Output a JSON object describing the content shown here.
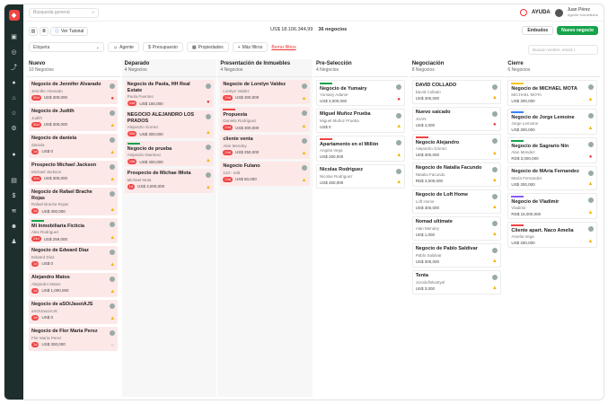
{
  "topbar": {
    "search_placeholder": "Búsqueda general",
    "ayuda": "AYUDA",
    "user_name": "Juan Pérez",
    "user_role": "Agente Inmobiliario"
  },
  "toolbar": {
    "tutorial": "Ver Tutorial",
    "total_amount": "US$ 18.106.344,99",
    "total_deals": "36 negocios",
    "embudos": "Embudos",
    "nuevo": "Nuevo negocio"
  },
  "filters": {
    "etiqueta": "Etiqueta",
    "agente": "Agente",
    "presupuesto": "Presupuesto",
    "propiedades": "Propiedades",
    "mas": "Más filtros",
    "borrar": "Borrar filtros",
    "board_search": "Buscar nombre, email, t"
  },
  "colors": {
    "red_badge": "#ef4444",
    "green": "#16a34a",
    "sidebar": "#1d2e2c"
  },
  "columns": [
    {
      "title": "Nuevo",
      "count": "10 Negocios",
      "shaded": false,
      "cards": [
        {
          "title": "Negocio de Jennifer Alvarado",
          "contact": "Jennifer Alvarado",
          "badge": "30d",
          "amount": "US$ 300,000",
          "bar": "",
          "red": true,
          "status": "err"
        },
        {
          "title": "Negocio de Judith",
          "contact": "Judith",
          "badge": "30d",
          "amount": "US$ 300,000",
          "bar": "",
          "red": true,
          "status": "warn"
        },
        {
          "title": "Negocio de daniela",
          "contact": "daniela",
          "badge": "1d",
          "amount": "US$ 0",
          "bar": "",
          "red": true,
          "status": "warn"
        },
        {
          "title": "Prospecto Michael Jackson",
          "contact": "Michael Jackson",
          "badge": "10d",
          "amount": "US$ 300,000",
          "bar": "",
          "red": true,
          "status": "warn"
        },
        {
          "title": "Negocio de Rafael Brache Rojas",
          "contact": "Rafael Brache Rojas",
          "badge": "1d",
          "amount": "US$ 300,000",
          "bar": "",
          "red": true,
          "status": "warn"
        },
        {
          "title": "Mi Inmobiliaria Ficticia",
          "contact": "Alex Rodriguez",
          "badge": "24d",
          "amount": "US$ 259,000",
          "bar": "#16a34a",
          "red": true,
          "status": "warn"
        },
        {
          "title": "Negocio de Edward Diaz",
          "contact": "Edward Díaz",
          "badge": "1d",
          "amount": "US$ 0",
          "bar": "",
          "red": true,
          "status": "warn"
        },
        {
          "title": "Alejandro Matos",
          "contact": "Alejandro Matos",
          "badge": "1d",
          "amount": "US$ 1,000,000",
          "bar": "",
          "red": true,
          "status": "warn"
        },
        {
          "title": "Negocio de aSOiJasoiAJS",
          "contact": "aSOiJasoiAJS",
          "badge": "1d",
          "amount": "US$ 0",
          "bar": "",
          "red": true,
          "status": "warn"
        },
        {
          "title": "Negocio de Flor Maria Perez",
          "contact": "Flor María Perez",
          "badge": "1d",
          "amount": "US$ 300,000",
          "bar": "",
          "red": true,
          "status": "ok"
        }
      ]
    },
    {
      "title": "Deparado",
      "count": "4 Negocios",
      "shaded": true,
      "cards": [
        {
          "title": "Negocio de Paola, HH Real Estate",
          "contact": "Paola Fuentes",
          "badge": "24d",
          "amount": "US$ 150,000",
          "bar": "",
          "red": true,
          "status": "err"
        },
        {
          "title": "NEGOCIO ALEJANDRO LOS PRADOS",
          "contact": "Alejandro Gomez",
          "badge": "30d",
          "amount": "US$ 300,000",
          "bar": "",
          "red": true,
          "status": "warn"
        },
        {
          "title": "Negocio de prueba",
          "contact": "Alejandro Martinez",
          "badge": "24d",
          "amount": "US$ 300,000",
          "bar": "#16a34a",
          "red": true,
          "status": "warn"
        },
        {
          "title": "Prospecto de Michae lMota",
          "contact": "Michael Mota",
          "badge": "1d",
          "amount": "US$ 3,000,000",
          "bar": "",
          "red": true,
          "status": "warn"
        }
      ]
    },
    {
      "title": "Presentación de Inmuebles",
      "count": "4 Negocios",
      "shaded": true,
      "cards": [
        {
          "title": "Negocio de Lorelyn Valdez",
          "contact": "Lorelyn Valdez",
          "badge": "24d",
          "amount": "US$ 300,000",
          "bar": "",
          "red": true,
          "status": "warn"
        },
        {
          "title": "Propuesta",
          "contact": "Daniela Rodriguez",
          "badge": "24d",
          "amount": "US$ 300,000",
          "bar": "#ef4444",
          "red": true,
          "status": "warn"
        },
        {
          "title": "cliente venta",
          "contact": "Alan Mendey",
          "badge": "24d",
          "amount": "US$ 250,000",
          "bar": "",
          "red": true,
          "status": "warn"
        },
        {
          "title": "Negocio Fulano",
          "contact": "123 - edit",
          "badge": "24d",
          "amount": "US$ 50,000",
          "bar": "",
          "red": true,
          "status": "warn"
        }
      ]
    },
    {
      "title": "Pre-Selección",
      "count": "4 Negocios",
      "shaded": false,
      "cards": [
        {
          "title": "Negocio de Yumairy",
          "contact": "Yumairy Adame",
          "badge": "",
          "amount": "US$ 3,000,000",
          "bar": "#16a34a",
          "red": false,
          "status": "err"
        },
        {
          "title": "Miguel Muñoz Prueba",
          "contact": "Miguel Muñoz Prueba",
          "badge": "",
          "amount": "US$ 0",
          "bar": "",
          "red": false,
          "status": "warn"
        },
        {
          "title": "Apartamento en el Millón",
          "contact": "Angela Vega",
          "badge": "",
          "amount": "US$ 250,000",
          "bar": "#ef4444",
          "red": false,
          "status": "warn"
        },
        {
          "title": "Nicolas Rodriguez",
          "contact": "Nicolas Rodriguez",
          "badge": "",
          "amount": "US$ 450,000",
          "bar": "",
          "red": false,
          "status": "warn"
        }
      ]
    },
    {
      "title": "Negociación",
      "count": "8 Negocios",
      "shaded": false,
      "cards": [
        {
          "title": "DAVID COLLADO",
          "contact": "David Collado",
          "badge": "",
          "amount": "US$ 300,000",
          "bar": "",
          "red": false,
          "status": "warn"
        },
        {
          "title": "Nuevo saicado",
          "contact": "JUAN",
          "badge": "",
          "amount": "US$ 4,000",
          "bar": "",
          "red": false,
          "status": "err"
        },
        {
          "title": "Negocio Alejandro",
          "contact": "Alejandro Gómez",
          "badge": "",
          "amount": "US$ 300,000",
          "bar": "#ef4444",
          "red": false,
          "status": "warn"
        },
        {
          "title": "Negocio de Natalia Facundo",
          "contact": "Natalia Facundo",
          "badge": "",
          "amount": "RD$ 3,000,000",
          "bar": "",
          "red": false,
          "status": "warn"
        },
        {
          "title": "Negocio de Loft Home",
          "contact": "Loft Home",
          "badge": "",
          "amount": "US$ 300,000",
          "bar": "",
          "red": false,
          "status": "warn"
        },
        {
          "title": "Nomad ultimate",
          "contact": "Alan Mendey",
          "badge": "",
          "amount": "US$ 1,000",
          "bar": "",
          "red": false,
          "status": "warn"
        },
        {
          "title": "Negocio de Pablo Saldivar",
          "contact": "Pablo Saldivar",
          "badge": "",
          "amount": "US$ 300,000",
          "bar": "",
          "red": false,
          "status": "warn"
        },
        {
          "title": "Tenta",
          "contact": "Jorodofinkostyel",
          "badge": "",
          "amount": "US$ 3,000",
          "bar": "",
          "red": false,
          "status": "warn"
        }
      ]
    },
    {
      "title": "Cierre",
      "count": "6 Negocios",
      "shaded": false,
      "cards": [
        {
          "title": "Negocio de MICHAEL MOTA",
          "contact": "MICHAEL MOTA",
          "badge": "",
          "amount": "US$ 300,000",
          "bar": "#f5c518",
          "red": false,
          "status": "warn"
        },
        {
          "title": "Negocio de Jorge Lemoine",
          "contact": "Jorge Lemoine",
          "badge": "",
          "amount": "US$ 300,000",
          "bar": "#3b82f6",
          "red": false,
          "status": "warn"
        },
        {
          "title": "Negocio de Sagrario Nin",
          "contact": "Alan Mendez",
          "badge": "",
          "amount": "RD$ 3,000,000",
          "bar": "#16a34a",
          "red": false,
          "status": "err"
        },
        {
          "title": "Negocio de MAria Fernandez",
          "contact": "María Fernandez",
          "badge": "",
          "amount": "US$ 300,000",
          "bar": "",
          "red": false,
          "status": "warn"
        },
        {
          "title": "Negocio de Vladimir",
          "contact": "Vladimir",
          "badge": "",
          "amount": "RD$ 15,000,000",
          "bar": "#8b5cf6",
          "red": false,
          "status": "warn"
        },
        {
          "title": "Cliente apart. Naco Amelia",
          "contact": "Amelia Vega",
          "badge": "",
          "amount": "US$ 250,000",
          "bar": "#ef4444",
          "red": false,
          "status": "warn"
        }
      ]
    }
  ]
}
